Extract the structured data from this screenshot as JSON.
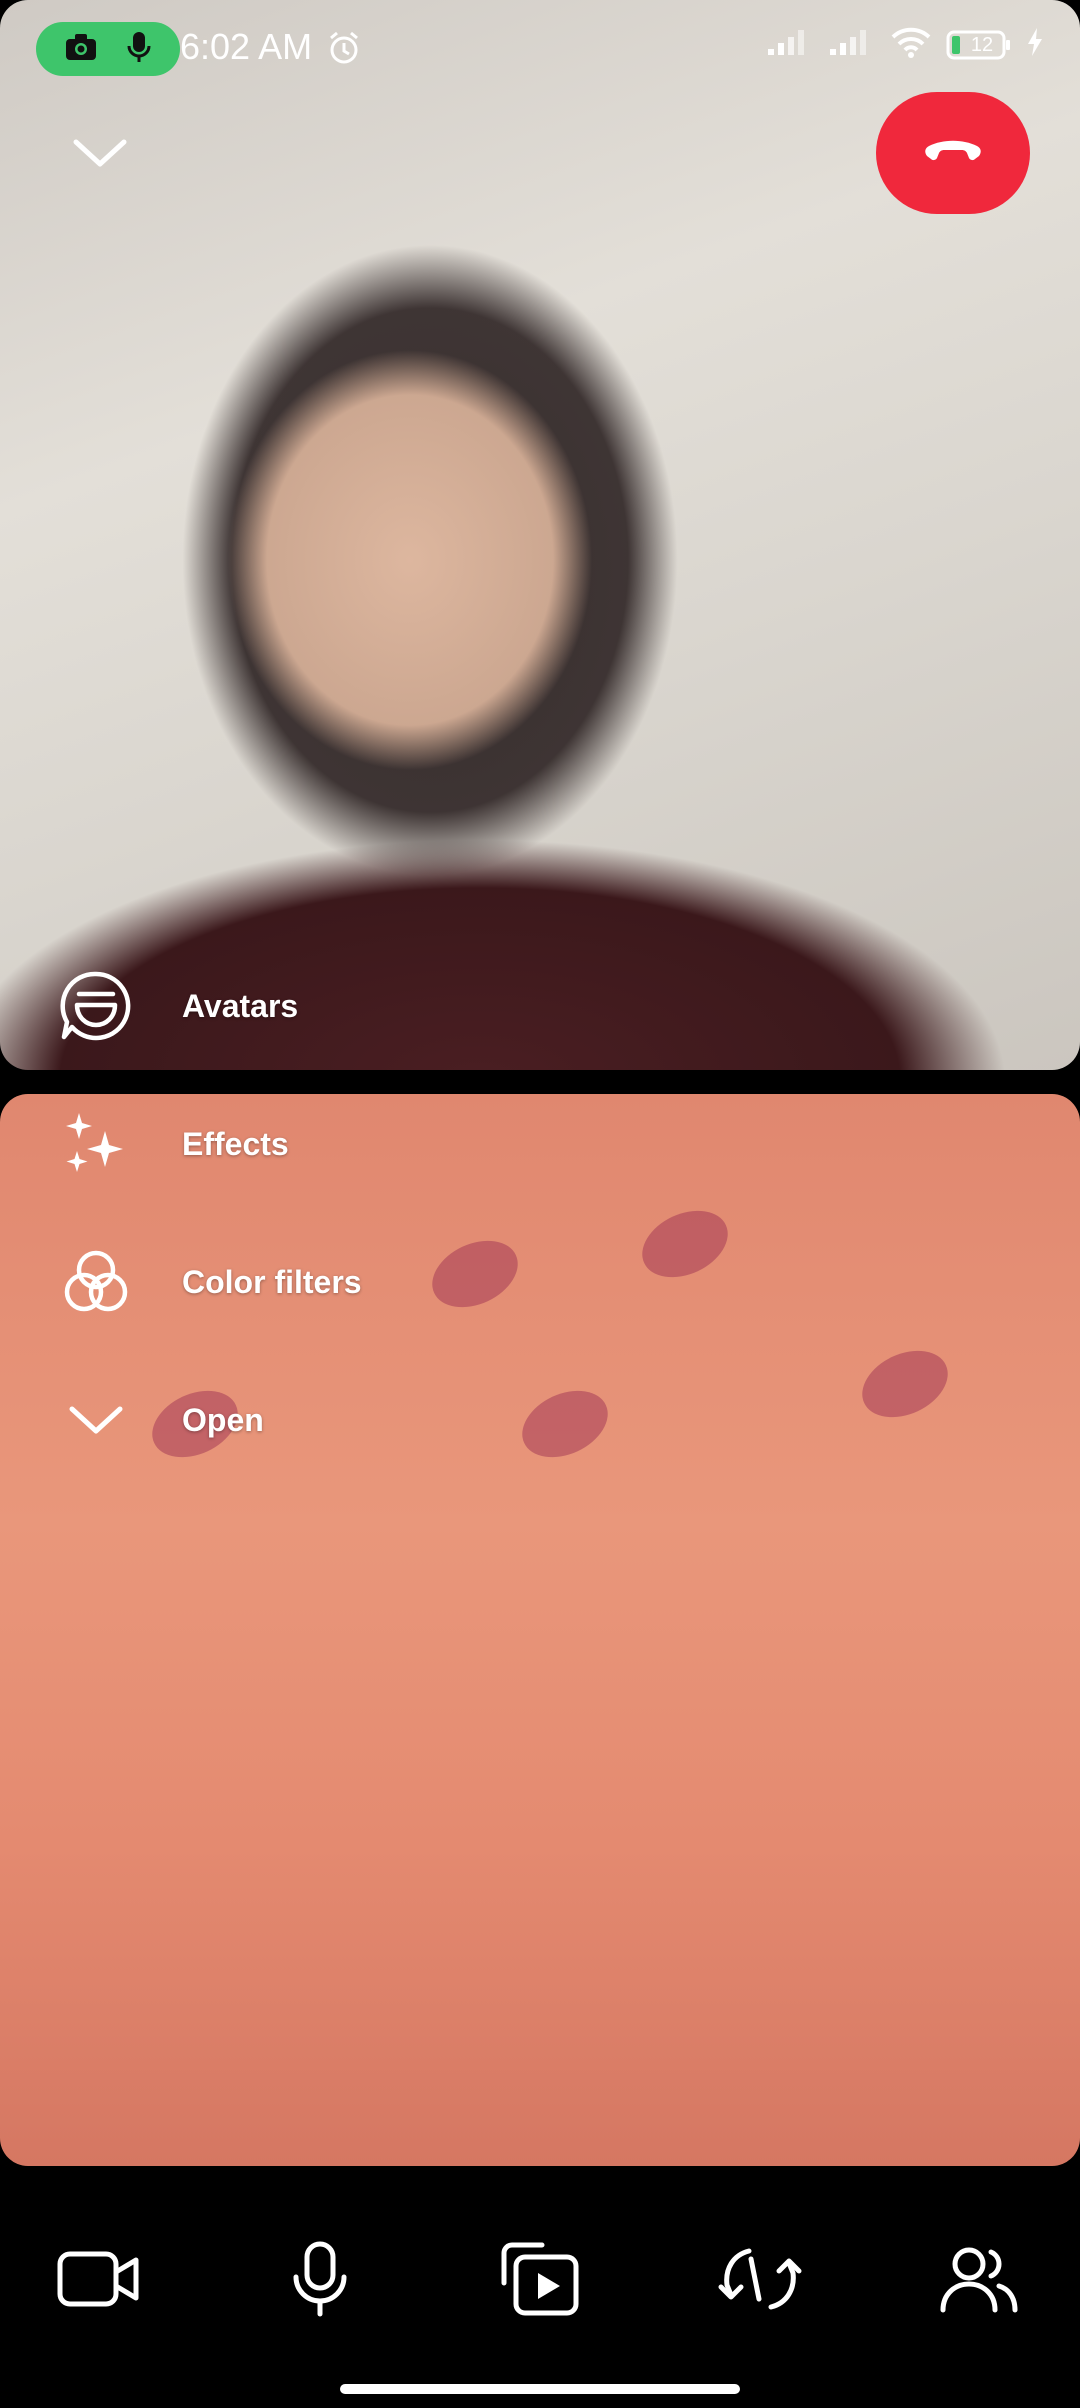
{
  "status_bar": {
    "time": "6:02 AM",
    "battery_level": "12",
    "icons": [
      "camera-icon",
      "mic-icon",
      "alarm-icon",
      "signal-icon",
      "signal-icon",
      "wifi-icon",
      "battery-icon",
      "charging-icon"
    ]
  },
  "call": {
    "collapse_icon": "chevron-down-icon",
    "end_call_icon": "hang-up-icon"
  },
  "effects_menu": {
    "items": [
      {
        "label": "Avatars",
        "icon": "avatar-face-icon"
      },
      {
        "label": "Effects",
        "icon": "sparkles-icon"
      },
      {
        "label": "Color filters",
        "icon": "color-filter-icon"
      },
      {
        "label": "Open",
        "icon": "chevron-down-icon"
      }
    ]
  },
  "controls": {
    "items": [
      {
        "icon": "video-camera-icon"
      },
      {
        "icon": "microphone-icon"
      },
      {
        "icon": "media-share-icon"
      },
      {
        "icon": "flip-camera-icon"
      },
      {
        "icon": "participants-icon"
      }
    ]
  },
  "colors": {
    "end_call": "#f0283c",
    "camera_in_use_pill": "#3ec56b",
    "battery_low": "#3ec56b"
  }
}
